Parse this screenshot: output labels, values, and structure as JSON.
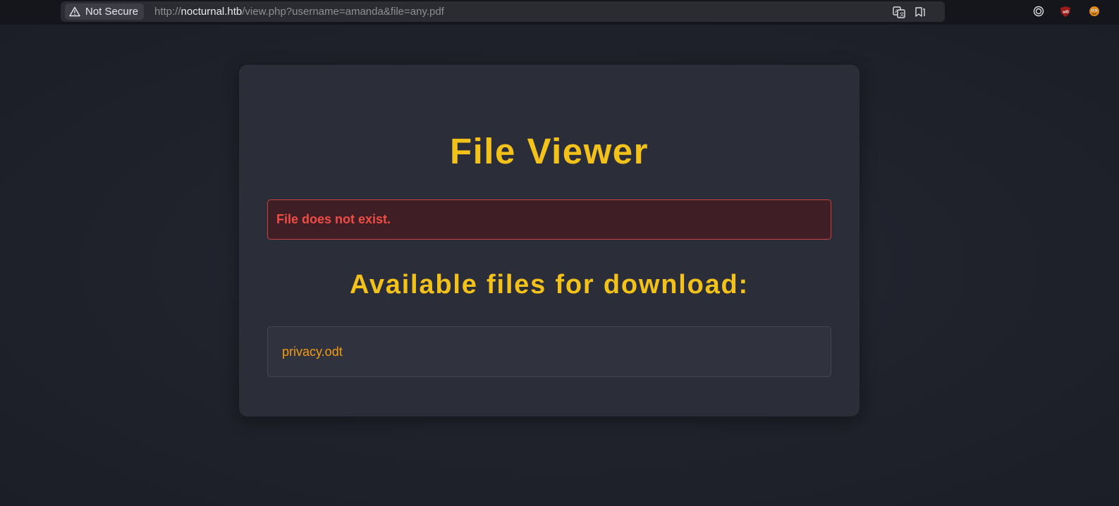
{
  "browser": {
    "security_label": "Not Secure",
    "url_scheme": "http://",
    "url_host": "nocturnal.htb",
    "url_path": "/view.php?username=amanda&file=any.pdf",
    "icons": [
      "warning-triangle-icon",
      "translate-icon",
      "reader-mode-icon",
      "tracking-protection-icon",
      "ublock-icon",
      "extension-icon"
    ]
  },
  "page": {
    "title": "File Viewer",
    "error_message": "File does not exist.",
    "files_heading": "Available files for download:",
    "files": [
      {
        "name": "privacy.odt"
      }
    ]
  },
  "colors": {
    "accent": "#f2c21b",
    "error": "#ee4c45",
    "file_link": "#f39c12",
    "card_bg": "#2b2d38",
    "page_bg": "#1e202a"
  }
}
